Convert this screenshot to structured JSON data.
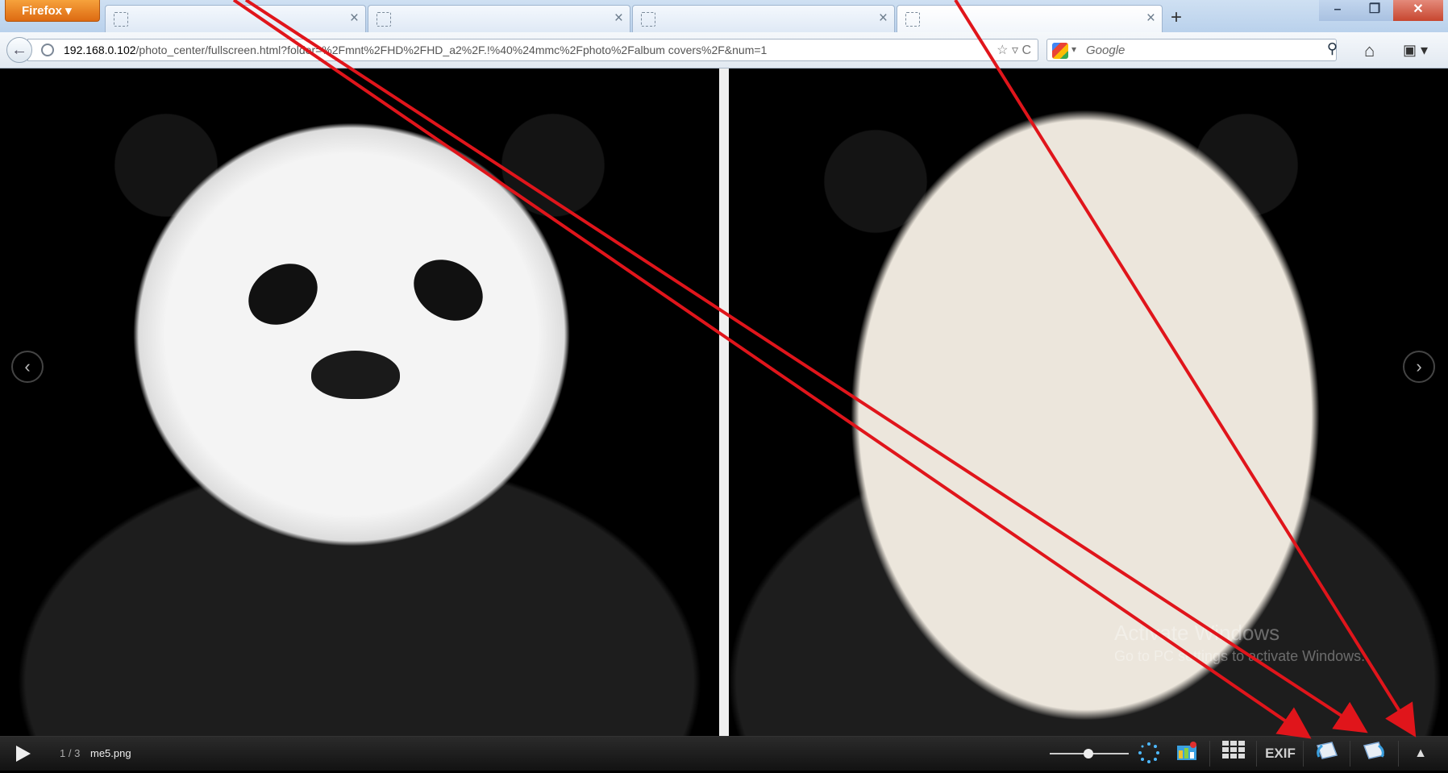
{
  "browser": {
    "menu_button": "Firefox ▾",
    "tabs": [
      {
        "title": "",
        "close": "×"
      },
      {
        "title": "",
        "close": "×"
      },
      {
        "title": "",
        "close": "×"
      },
      {
        "title": "",
        "close": "×"
      }
    ],
    "new_tab": "+",
    "window": {
      "minimize": "–",
      "maximize": "❐",
      "close": "✕"
    },
    "back": "←",
    "url_host": "192.168.0.102",
    "url_rest": "/photo_center/fullscreen.html?folder=%2Fmnt%2FHD%2FHD_a2%2F.!%40%24mmc%2Fphoto%2Falbum covers%2F&num=1",
    "url_icons": "☆ ▿ C",
    "search_dropdown": "▾",
    "search_placeholder": "Google",
    "search_icon": "⚲",
    "home": "⌂",
    "bookmarks": "▣ ▾"
  },
  "viewer": {
    "prev": "‹",
    "next": "›",
    "watermark_title": "Activate Windows",
    "watermark_sub": "Go to PC settings to activate Windows."
  },
  "toolbar": {
    "counter": "1 / 3",
    "filename": "me5.png",
    "exif": "EXIF",
    "up_arrow": "▲"
  },
  "annotation_color": "#e0151b"
}
